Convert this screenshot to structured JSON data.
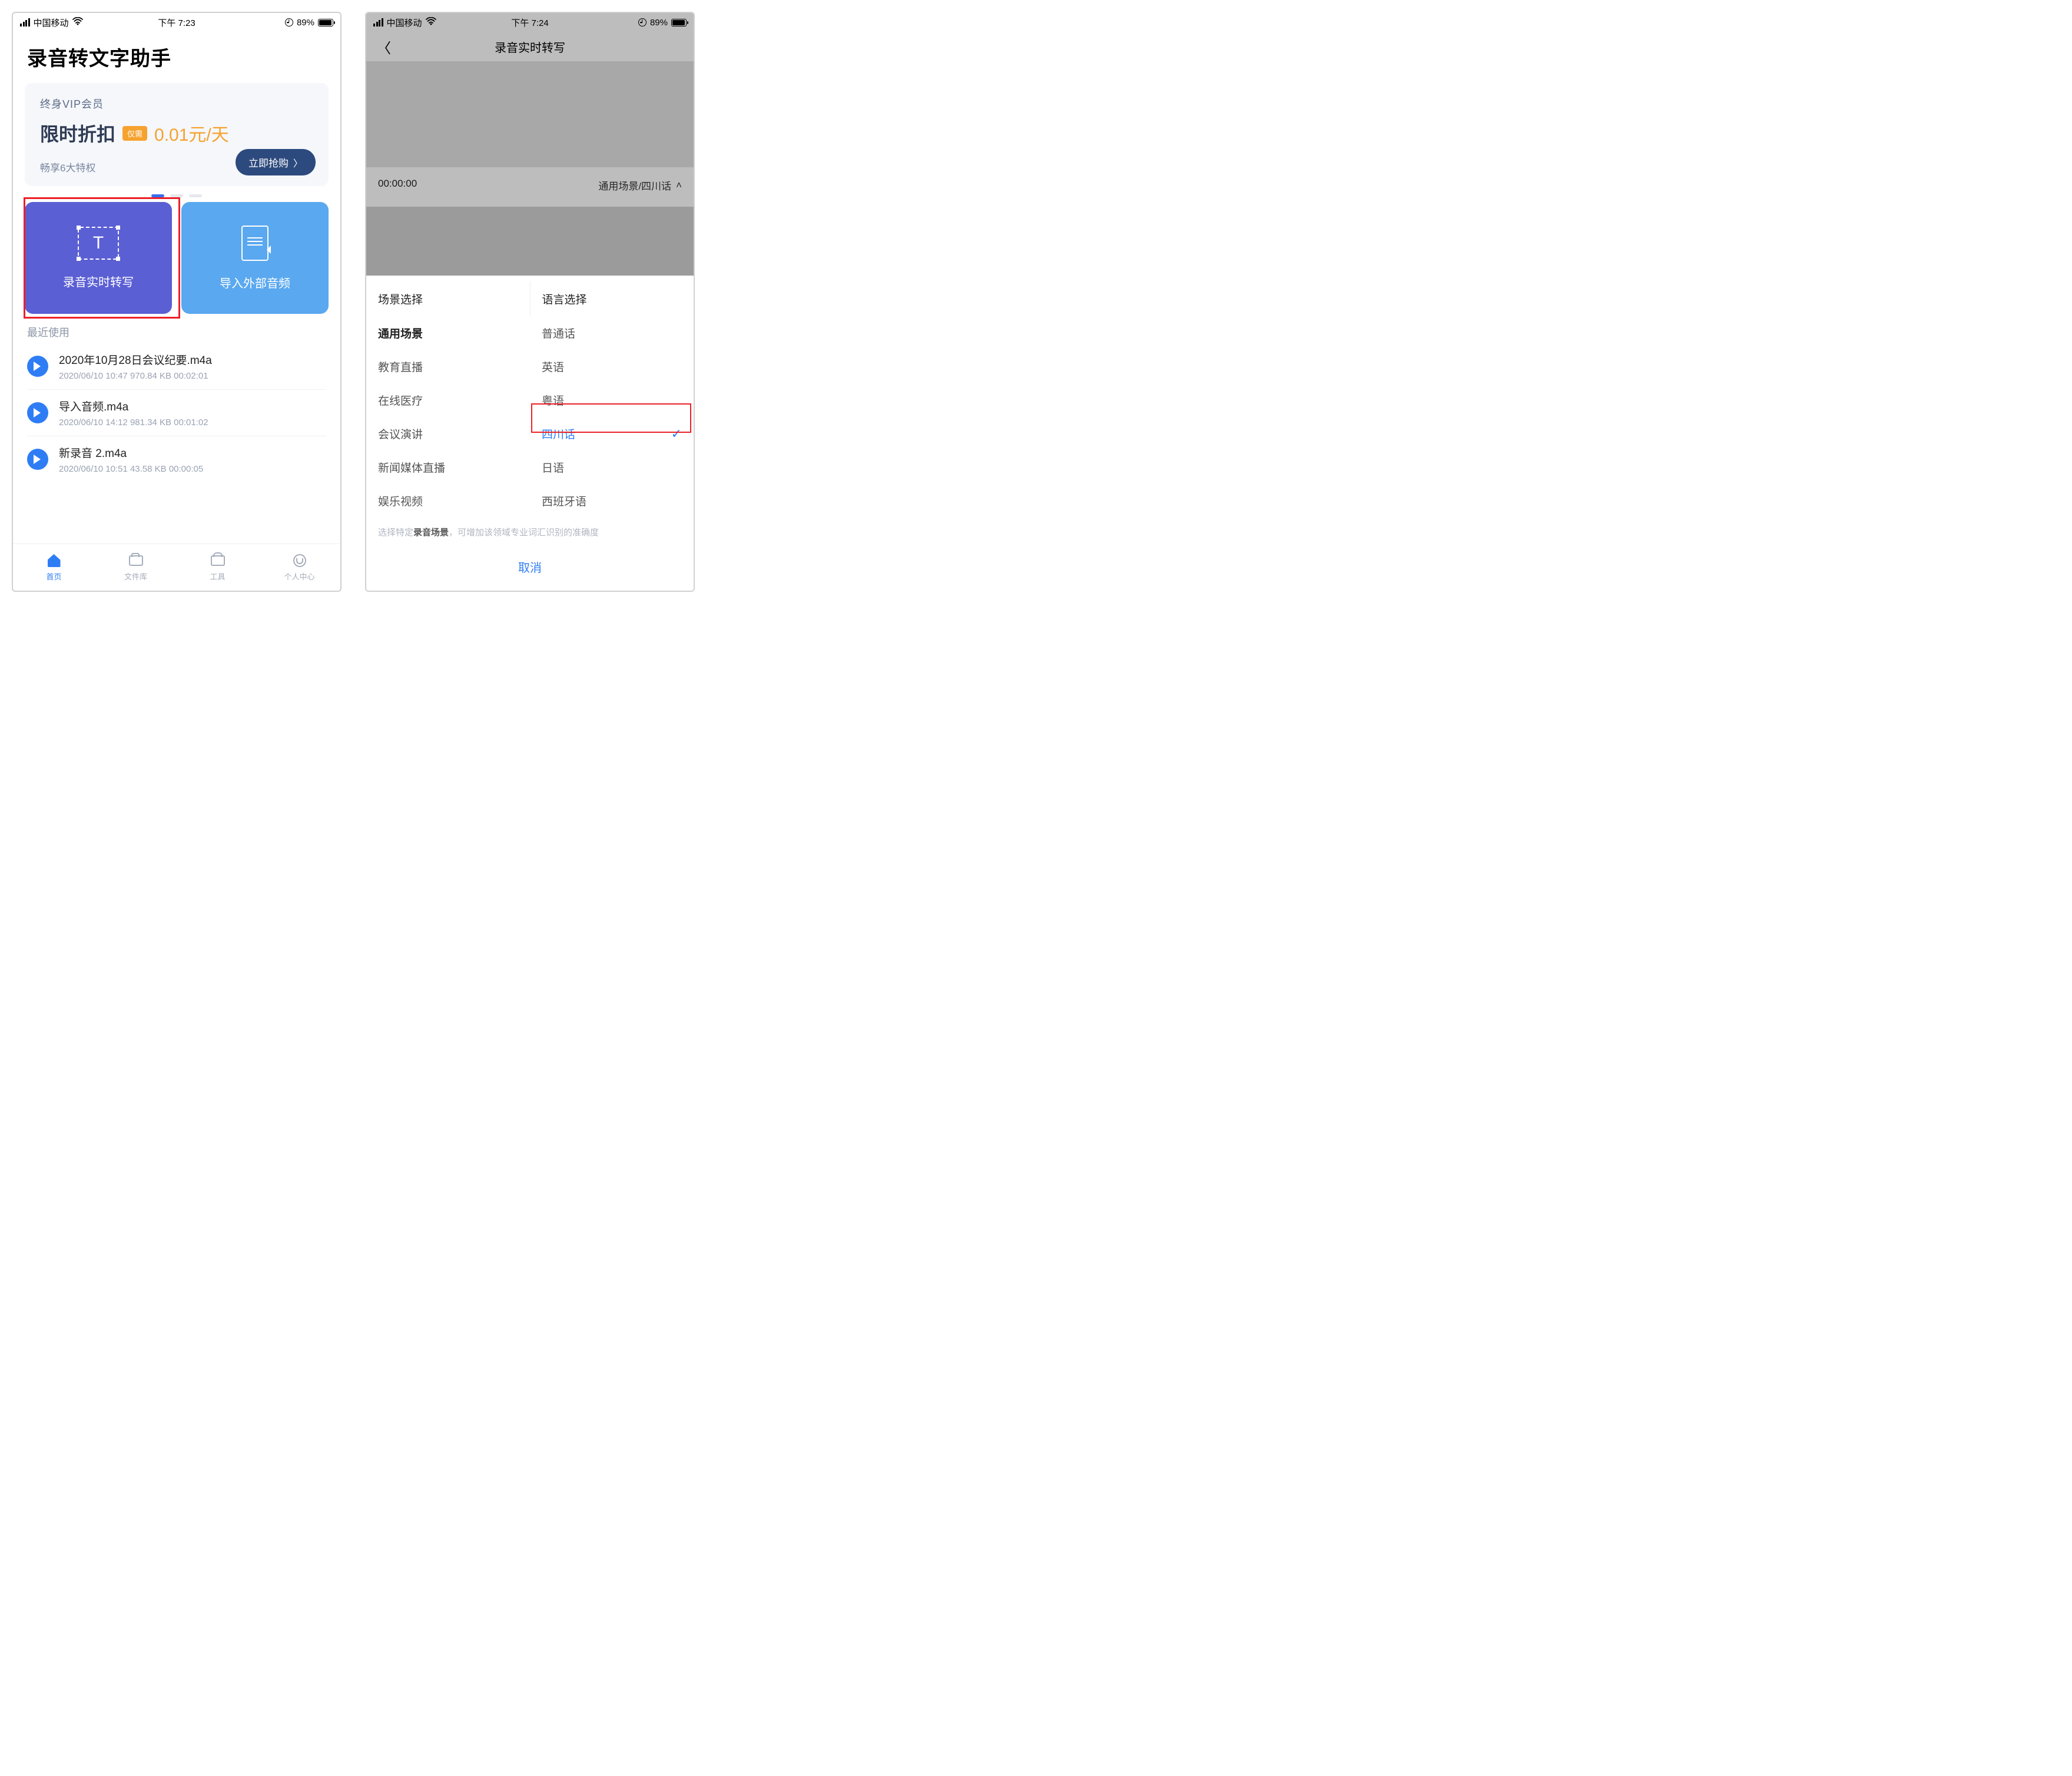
{
  "screen1": {
    "status": {
      "carrier": "中国移动",
      "time": "下午 7:23",
      "battery_pct": "89%"
    },
    "app_title": "录音转文字助手",
    "vip": {
      "top": "终身VIP会员",
      "discount": "限时折扣",
      "tag": "仅需",
      "price": "0.01元/天",
      "sub": "畅享6大特权",
      "btn": "立即抢购"
    },
    "cards": {
      "realtime": "录音实时转写",
      "import": "导入外部音频"
    },
    "recent_label": "最近使用",
    "files": [
      {
        "name": "2020年10月28日会议纪要.m4a",
        "meta": "2020/06/10 10:47  970.84 KB  00:02:01"
      },
      {
        "name": "导入音频.m4a",
        "meta": "2020/06/10 14:12  981.34 KB  00:01:02"
      },
      {
        "name": "新录音 2.m4a",
        "meta": "2020/06/10 10:51  43.58 KB  00:00:05"
      }
    ],
    "tabs": {
      "home": "首页",
      "files": "文件库",
      "tools": "工具",
      "me": "个人中心"
    }
  },
  "screen2": {
    "status": {
      "carrier": "中国移动",
      "time": "下午 7:24",
      "battery_pct": "89%"
    },
    "nav_title": "录音实时转写",
    "timer": "00:00:00",
    "scene_lang": "通用场景/四川话",
    "sheet": {
      "col1_header": "场景选择",
      "col2_header": "语言选择",
      "scenes": [
        "通用场景",
        "教育直播",
        "在线医疗",
        "会议演讲",
        "新闻媒体直播",
        "娱乐视频"
      ],
      "langs": [
        "普通话",
        "英语",
        "粤语",
        "四川话",
        "日语",
        "西班牙语"
      ],
      "selected_lang_index": 3,
      "hint_pre": "选择特定",
      "hint_em": "录音场景",
      "hint_post": "，可增加该领域专业词汇识别的准确度",
      "cancel": "取消"
    }
  }
}
